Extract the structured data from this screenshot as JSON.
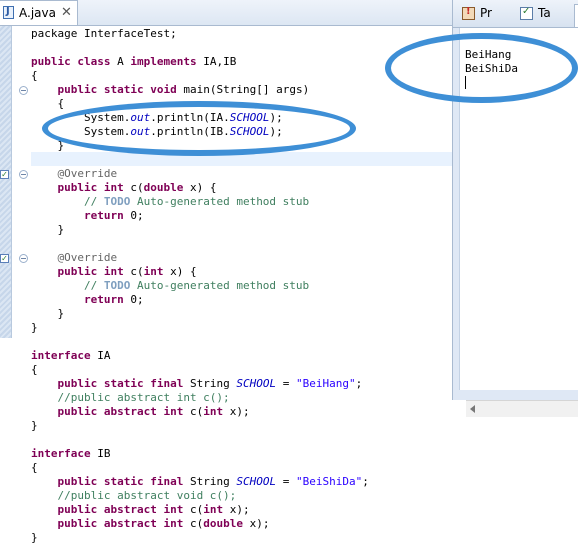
{
  "editor": {
    "tab_label": "A.java",
    "tab_close": "✕",
    "code_lines": [
      [
        [
          "package InterfaceTest;",
          ""
        ]
      ],
      [
        [
          "",
          ""
        ]
      ],
      [
        [
          "public",
          "kw"
        ],
        [
          " ",
          ""
        ],
        [
          "class",
          "kw"
        ],
        [
          " A ",
          ""
        ],
        [
          "implements",
          "kw"
        ],
        [
          " IA,IB",
          ""
        ]
      ],
      [
        [
          "{",
          ""
        ]
      ],
      [
        [
          "    ",
          ""
        ],
        [
          "public",
          "kw"
        ],
        [
          " ",
          ""
        ],
        [
          "static",
          "kw"
        ],
        [
          " ",
          ""
        ],
        [
          "void",
          "kw"
        ],
        [
          " main(String[] args)",
          ""
        ]
      ],
      [
        [
          "    {",
          ""
        ]
      ],
      [
        [
          "        System.",
          ""
        ],
        [
          "out",
          "fld"
        ],
        [
          ".println(IA.",
          ""
        ],
        [
          "SCHOOL",
          "fld"
        ],
        [
          ");",
          ""
        ]
      ],
      [
        [
          "        System.",
          ""
        ],
        [
          "out",
          "fld"
        ],
        [
          ".println(IB.",
          ""
        ],
        [
          "SCHOOL",
          "fld"
        ],
        [
          ");",
          ""
        ]
      ],
      [
        [
          "    }",
          ""
        ]
      ],
      [
        [
          "",
          ""
        ]
      ],
      [
        [
          "    @Override",
          "ann"
        ]
      ],
      [
        [
          "    ",
          ""
        ],
        [
          "public",
          "kw"
        ],
        [
          " ",
          ""
        ],
        [
          "int",
          "kw"
        ],
        [
          " c(",
          ""
        ],
        [
          "double",
          "kw"
        ],
        [
          " x) {",
          ""
        ]
      ],
      [
        [
          "        // ",
          "cmt"
        ],
        [
          "TODO",
          "todo"
        ],
        [
          " Auto-generated method stub",
          "cmt"
        ]
      ],
      [
        [
          "        ",
          ""
        ],
        [
          "return",
          "kw"
        ],
        [
          " 0;",
          ""
        ]
      ],
      [
        [
          "    }",
          ""
        ]
      ],
      [
        [
          "",
          ""
        ]
      ],
      [
        [
          "    @Override",
          "ann"
        ]
      ],
      [
        [
          "    ",
          ""
        ],
        [
          "public",
          "kw"
        ],
        [
          " ",
          ""
        ],
        [
          "int",
          "kw"
        ],
        [
          " c(",
          ""
        ],
        [
          "int",
          "kw"
        ],
        [
          " x) {",
          ""
        ]
      ],
      [
        [
          "        // ",
          "cmt"
        ],
        [
          "TODO",
          "todo"
        ],
        [
          " Auto-generated method stub",
          "cmt"
        ]
      ],
      [
        [
          "        ",
          ""
        ],
        [
          "return",
          "kw"
        ],
        [
          " 0;",
          ""
        ]
      ],
      [
        [
          "    }",
          ""
        ]
      ],
      [
        [
          "}",
          ""
        ]
      ],
      [
        [
          "",
          ""
        ]
      ],
      [
        [
          "interface",
          "kw"
        ],
        [
          " IA",
          ""
        ]
      ],
      [
        [
          "{",
          ""
        ]
      ],
      [
        [
          "    ",
          ""
        ],
        [
          "public",
          "kw"
        ],
        [
          " ",
          ""
        ],
        [
          "static",
          "kw"
        ],
        [
          " ",
          ""
        ],
        [
          "final",
          "kw"
        ],
        [
          " String ",
          ""
        ],
        [
          "SCHOOL",
          "fld"
        ],
        [
          " = ",
          ""
        ],
        [
          "\"BeiHang\"",
          "str"
        ],
        [
          ";",
          ""
        ]
      ],
      [
        [
          "    //public abstract int c();",
          "cmt"
        ]
      ],
      [
        [
          "    ",
          ""
        ],
        [
          "public",
          "kw"
        ],
        [
          " ",
          ""
        ],
        [
          "abstract",
          "kw"
        ],
        [
          " ",
          ""
        ],
        [
          "int",
          "kw"
        ],
        [
          " c(",
          ""
        ],
        [
          "int",
          "kw"
        ],
        [
          " x);",
          ""
        ]
      ],
      [
        [
          "}",
          ""
        ]
      ],
      [
        [
          "",
          ""
        ]
      ],
      [
        [
          "interface",
          "kw"
        ],
        [
          " IB",
          ""
        ]
      ],
      [
        [
          "{",
          ""
        ]
      ],
      [
        [
          "    ",
          ""
        ],
        [
          "public",
          "kw"
        ],
        [
          " ",
          ""
        ],
        [
          "static",
          "kw"
        ],
        [
          " ",
          ""
        ],
        [
          "final",
          "kw"
        ],
        [
          " String ",
          ""
        ],
        [
          "SCHOOL",
          "fld"
        ],
        [
          " = ",
          ""
        ],
        [
          "\"BeiShiDa\"",
          "str"
        ],
        [
          ";",
          ""
        ]
      ],
      [
        [
          "    //public abstract void c();",
          "cmt"
        ]
      ],
      [
        [
          "    ",
          ""
        ],
        [
          "public",
          "kw"
        ],
        [
          " ",
          ""
        ],
        [
          "abstract",
          "kw"
        ],
        [
          " ",
          ""
        ],
        [
          "int",
          "kw"
        ],
        [
          " c(",
          ""
        ],
        [
          "int",
          "kw"
        ],
        [
          " x);",
          ""
        ]
      ],
      [
        [
          "    ",
          ""
        ],
        [
          "public",
          "kw"
        ],
        [
          " ",
          ""
        ],
        [
          "abstract",
          "kw"
        ],
        [
          " ",
          ""
        ],
        [
          "int",
          "kw"
        ],
        [
          " c(",
          ""
        ],
        [
          "double",
          "kw"
        ],
        [
          " x);",
          ""
        ]
      ],
      [
        [
          "}",
          ""
        ]
      ]
    ],
    "gutter_markers": [
      {
        "line": 11,
        "icon": "override-marker-icon",
        "glyph": "✓"
      },
      {
        "line": 17,
        "icon": "override-marker-icon",
        "glyph": "✓"
      }
    ],
    "fold_lines": [
      4,
      10,
      16
    ]
  },
  "console": {
    "tabs": [
      {
        "label": "Pr",
        "icon": "problems-icon"
      },
      {
        "label": "Ta",
        "icon": "tasks-icon"
      }
    ],
    "output_lines": [
      "BeiHang",
      "BeiShiDa"
    ]
  },
  "colors": {
    "keyword": "#7f0055",
    "field": "#0000c0",
    "string": "#2a00ff",
    "comment": "#3f7f5f",
    "annotation_circle": "#3e8fd6"
  }
}
